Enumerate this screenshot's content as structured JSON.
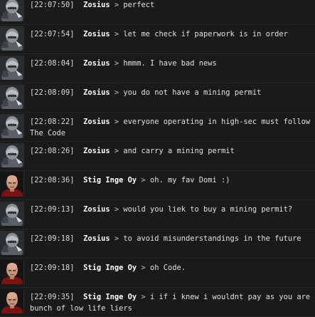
{
  "separator": ">",
  "avatar_icons": {
    "Zosius": "armored-pilot-portrait-icon",
    "Stig Inge Oy": "bald-red-uniform-pilot-portrait-icon"
  },
  "messages": [
    {
      "time": "[22:07:50]",
      "sender": "Zosius",
      "text": "perfect"
    },
    {
      "time": "[22:07:54]",
      "sender": "Zosius",
      "text": "let me check if paperwork is in order"
    },
    {
      "time": "[22:08:04]",
      "sender": "Zosius",
      "text": "hmmm. I have bad news"
    },
    {
      "time": "[22:08:09]",
      "sender": "Zosius",
      "text": "you do not have a mining permit"
    },
    {
      "time": "[22:08:22]",
      "sender": "Zosius",
      "text": "everyone operating in high-sec must follow The Code"
    },
    {
      "time": "[22:08:26]",
      "sender": "Zosius",
      "text": "and carry a mining permit"
    },
    {
      "time": "[22:08:36]",
      "sender": "Stig Inge Oy",
      "text": "oh. my fav Domi :)"
    },
    {
      "time": "[22:09:13]",
      "sender": "Zosius",
      "text": "would you liek to buy a mining permit?"
    },
    {
      "time": "[22:09:18]",
      "sender": "Zosius",
      "text": "to avoid misunderstandings in the future"
    },
    {
      "time": "[22:09:18]",
      "sender": "Stig Inge Oy",
      "text": "oh Code."
    },
    {
      "time": "[22:09:35]",
      "sender": "Stig Inge Oy",
      "text": "i if i knew i wouldnt pay as you are bunch of low life liers"
    }
  ]
}
